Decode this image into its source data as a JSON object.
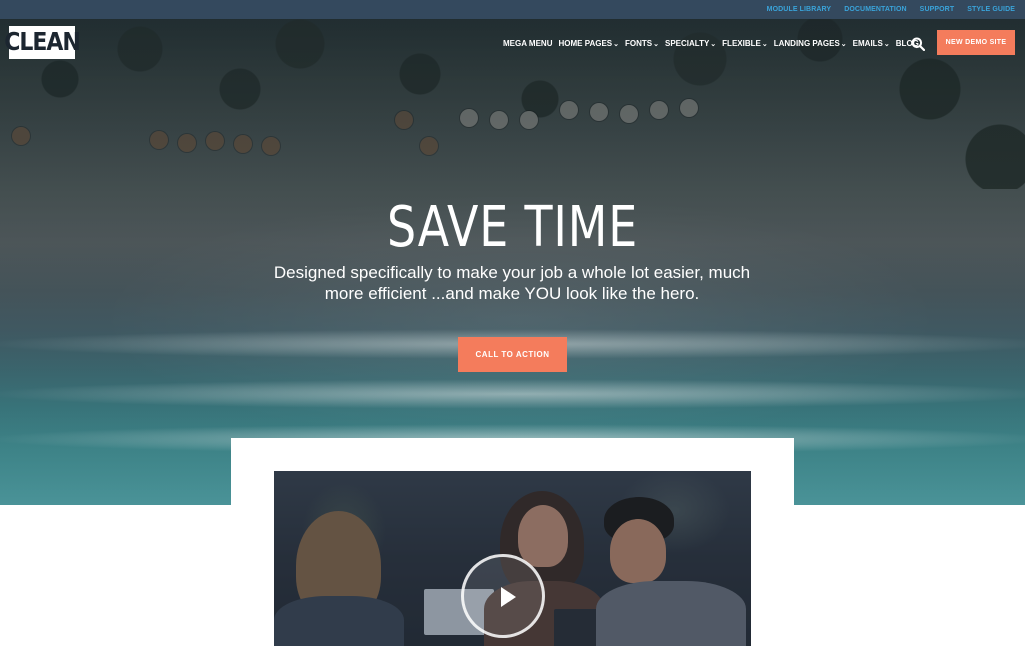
{
  "topbar": {
    "links": [
      "MODULE LIBRARY",
      "DOCUMENTATION",
      "SUPPORT",
      "STYLE GUIDE"
    ]
  },
  "header": {
    "logo": "CLEAN",
    "nav": [
      {
        "label": "MEGA MENU",
        "dropdown": false
      },
      {
        "label": "HOME PAGES",
        "dropdown": true
      },
      {
        "label": "FONTS",
        "dropdown": true
      },
      {
        "label": "SPECIALTY",
        "dropdown": true
      },
      {
        "label": "FLEXIBLE",
        "dropdown": true
      },
      {
        "label": "LANDING PAGES",
        "dropdown": true
      },
      {
        "label": "EMAILS",
        "dropdown": true
      },
      {
        "label": "BLOG",
        "dropdown": false
      }
    ],
    "search_icon": "search-icon",
    "demo_button": "NEW DEMO SITE"
  },
  "hero": {
    "headline": "SAVE TIME",
    "subheadline": "Designed specifically to make your job a whole lot easier, much more efficient ...and make YOU look like the hero.",
    "cta": "CALL TO ACTION"
  },
  "video": {
    "play_icon": "play-icon"
  },
  "colors": {
    "accent": "#f47c5c",
    "topbar_bg": "#34495e",
    "topbar_link": "#3aa3d9"
  }
}
